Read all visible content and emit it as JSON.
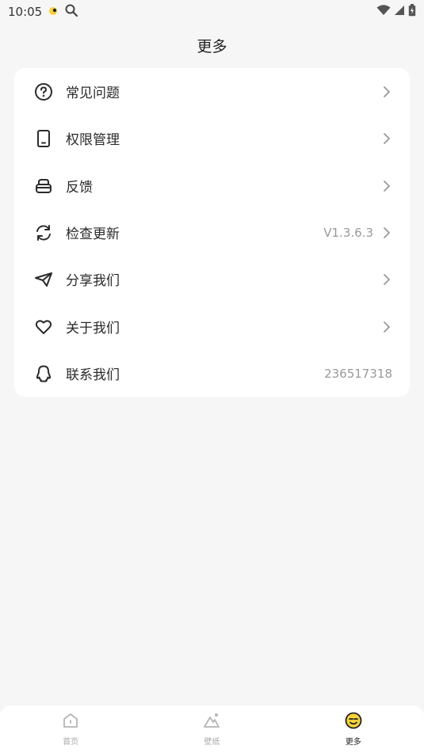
{
  "status_bar": {
    "time": "10:05"
  },
  "header": {
    "title": "更多"
  },
  "menu": {
    "items": [
      {
        "label": "常见问题",
        "value": "",
        "icon": "question-circle-icon"
      },
      {
        "label": "权限管理",
        "value": "",
        "icon": "phone-icon"
      },
      {
        "label": "反馈",
        "value": "",
        "icon": "feedback-icon"
      },
      {
        "label": "检查更新",
        "value": "V1.3.6.3",
        "icon": "refresh-icon"
      },
      {
        "label": "分享我们",
        "value": "",
        "icon": "paper-plane-icon"
      },
      {
        "label": "关于我们",
        "value": "",
        "icon": "heart-icon"
      },
      {
        "label": "联系我们",
        "value": "236517318",
        "icon": "qq-icon"
      }
    ]
  },
  "bottom_nav": {
    "items": [
      {
        "label": "首页",
        "icon": "home-icon",
        "active": false
      },
      {
        "label": "壁纸",
        "icon": "wallpaper-icon",
        "active": false
      },
      {
        "label": "更多",
        "icon": "more-face-icon",
        "active": true
      }
    ]
  },
  "colors": {
    "background": "#f6f6f6",
    "card": "#ffffff",
    "accent": "#f7d23a"
  }
}
